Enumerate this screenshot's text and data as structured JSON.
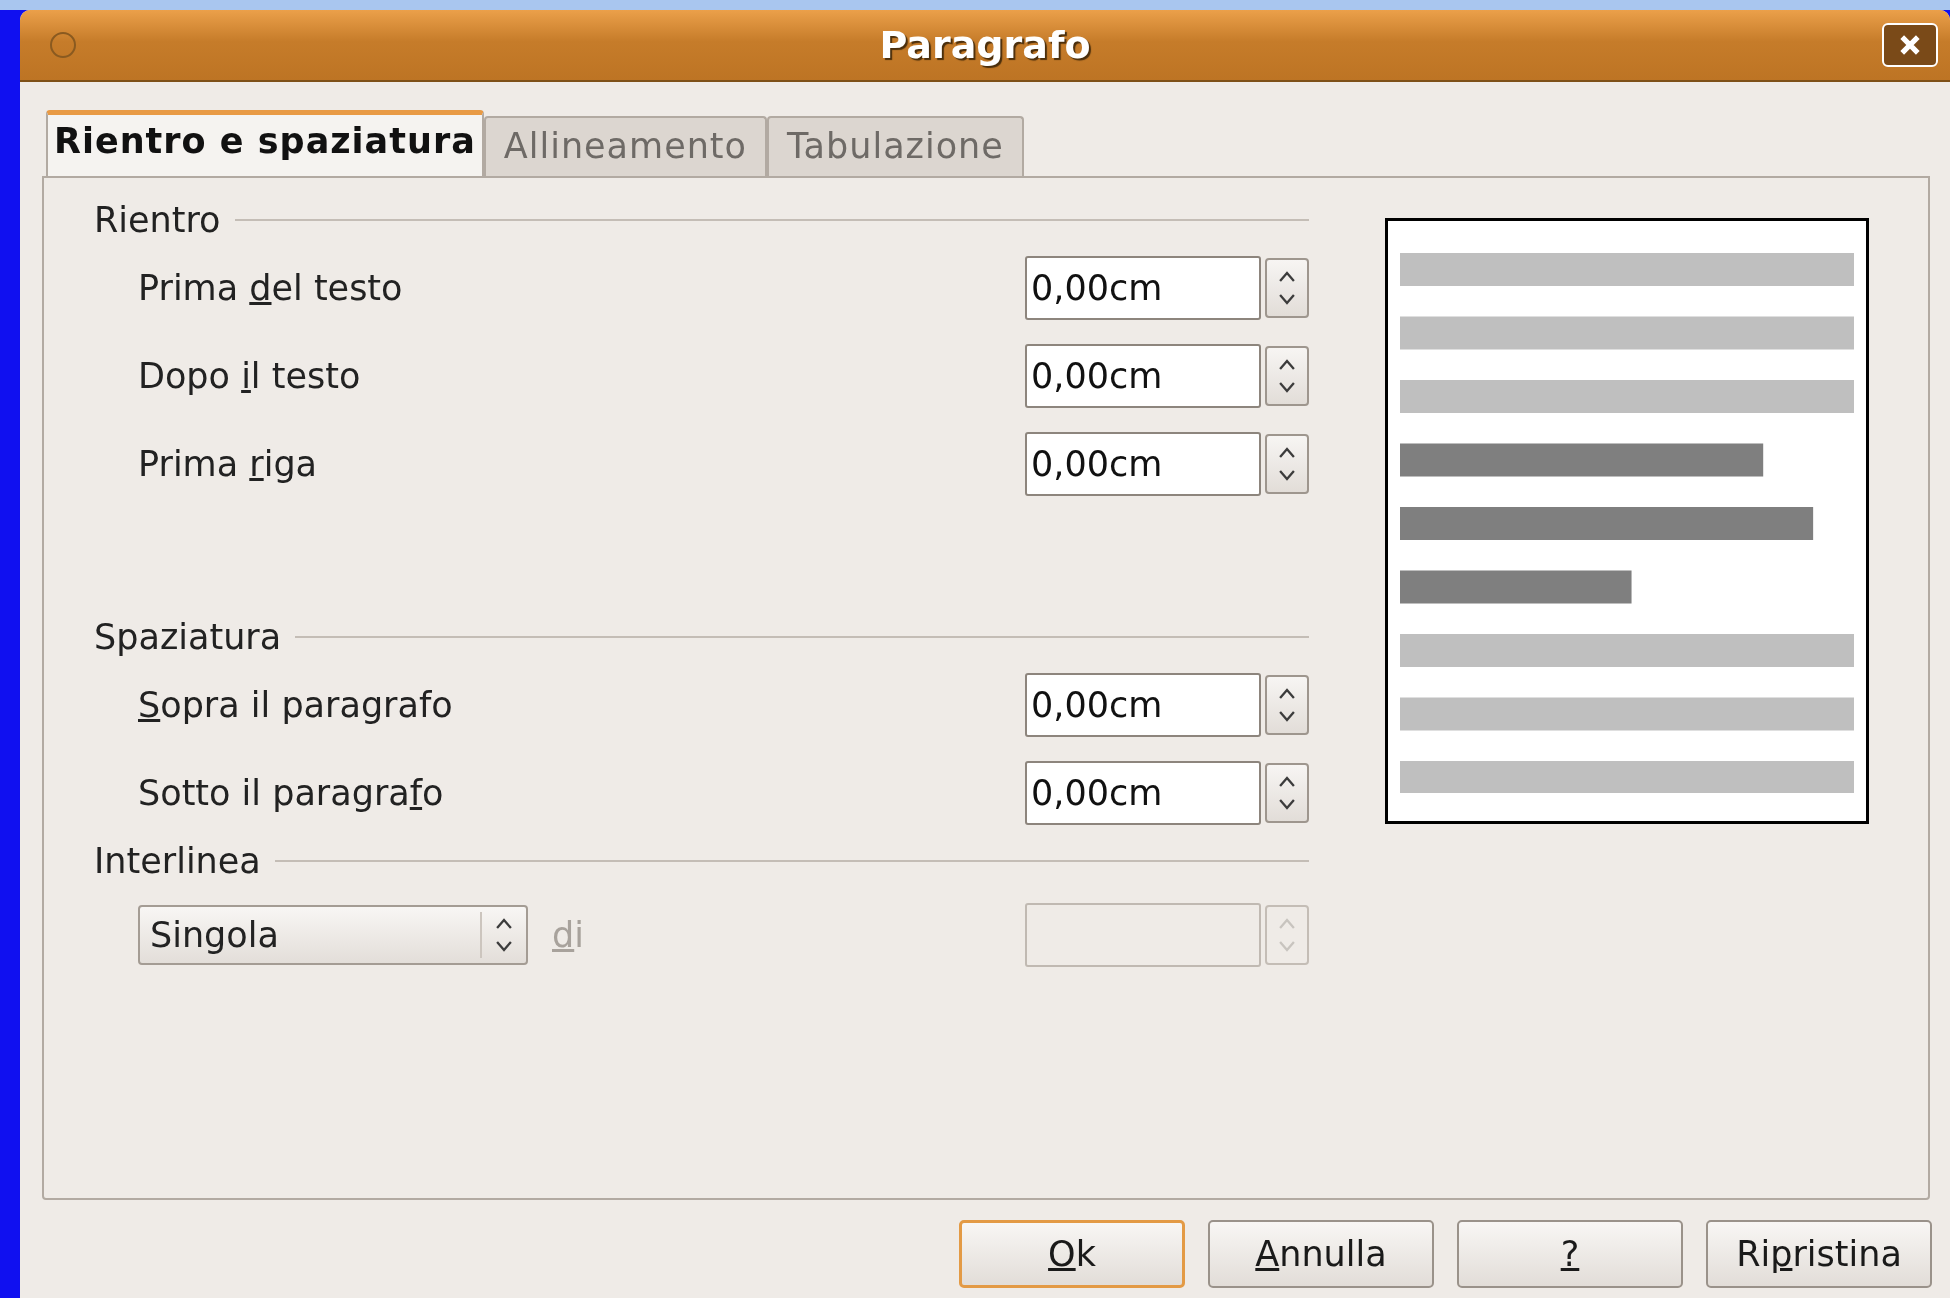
{
  "window": {
    "title": "Paragrafo"
  },
  "tabs": [
    {
      "label": "Rientro e spaziatura",
      "selected": true
    },
    {
      "label": "Allineamento",
      "selected": false
    },
    {
      "label": "Tabulazione",
      "selected": false
    }
  ],
  "sections": [
    {
      "title": "Rientro",
      "rows": [
        {
          "label": {
            "before": "Prima ",
            "key": "d",
            "after": "el testo"
          },
          "value": "0,00cm"
        },
        {
          "label": {
            "before": "Dopo ",
            "key": "i",
            "after": "l testo"
          },
          "value": "0,00cm"
        },
        {
          "label": {
            "before": "Prima ",
            "key": "r",
            "after": "iga"
          },
          "value": "0,00cm"
        }
      ]
    },
    {
      "title": "Spaziatura",
      "rows": [
        {
          "label": {
            "key": "S",
            "after": "opra il paragrafo"
          },
          "value": "0,00cm"
        },
        {
          "label": {
            "before": "Sotto il paragra",
            "key": "f",
            "after": "o"
          },
          "value": "0,00cm"
        }
      ]
    },
    {
      "title": "Interlinea",
      "line_spacing": {
        "value": "Singola",
        "of_label": {
          "key": "d",
          "after": "i"
        },
        "disabled": true
      }
    }
  ],
  "buttons": [
    {
      "label": {
        "key": "O",
        "after": "k"
      },
      "default": true
    },
    {
      "label": {
        "key": "A",
        "after": "nnulla"
      },
      "default": false
    },
    {
      "label": {
        "key": "?"
      },
      "default": false
    },
    {
      "label": {
        "before": "Ri",
        "key": "p",
        "after": "ristina"
      },
      "default": false
    }
  ]
}
